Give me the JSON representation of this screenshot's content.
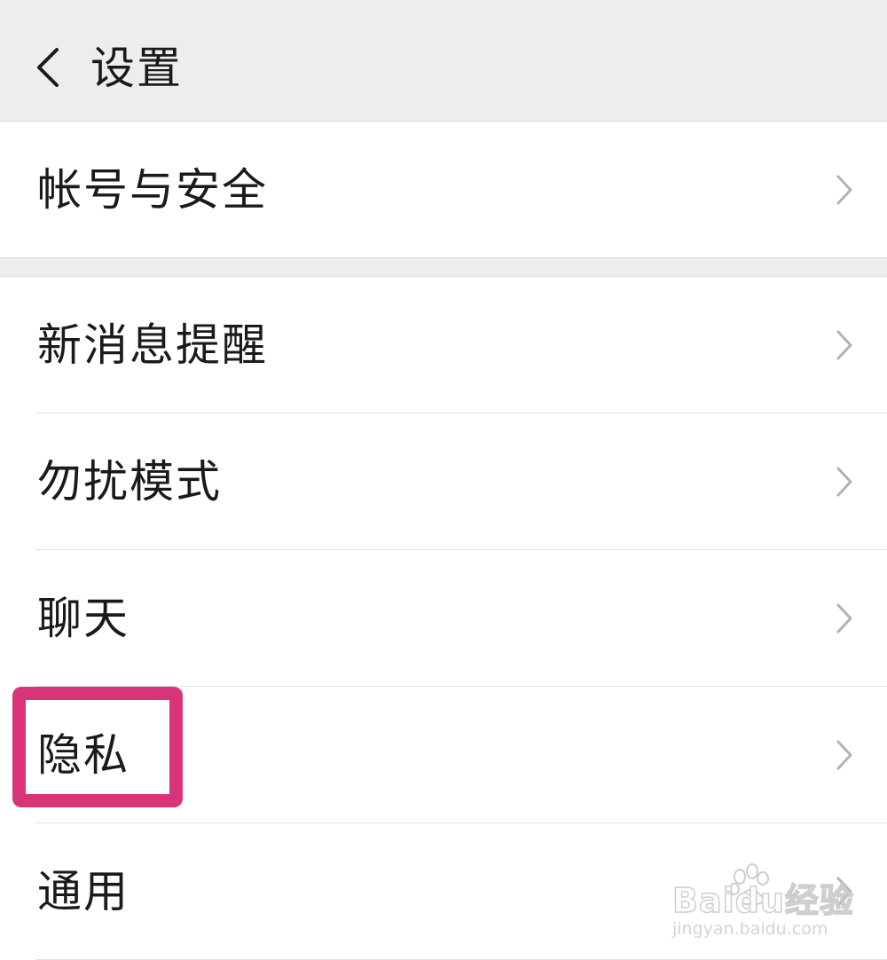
{
  "header": {
    "title": "设置",
    "back_icon": "chevron-left-icon"
  },
  "groups": [
    {
      "items": [
        {
          "label": "帐号与安全",
          "icon": "chevron-right-icon"
        }
      ]
    },
    {
      "items": [
        {
          "label": "新消息提醒",
          "icon": "chevron-right-icon"
        },
        {
          "label": "勿扰模式",
          "icon": "chevron-right-icon"
        },
        {
          "label": "聊天",
          "icon": "chevron-right-icon"
        },
        {
          "label": "隐私",
          "icon": "chevron-right-icon",
          "highlighted": true
        },
        {
          "label": "通用",
          "icon": "chevron-right-icon"
        }
      ]
    }
  ],
  "annotation": {
    "highlight_color": "#d9347a"
  },
  "watermark": {
    "brand": "Baidu经验",
    "url": "jingyan.baidu.com"
  },
  "colors": {
    "background": "#ededed",
    "card": "#ffffff",
    "text": "#1a1a1a",
    "chevron": "#b2b2b2"
  }
}
